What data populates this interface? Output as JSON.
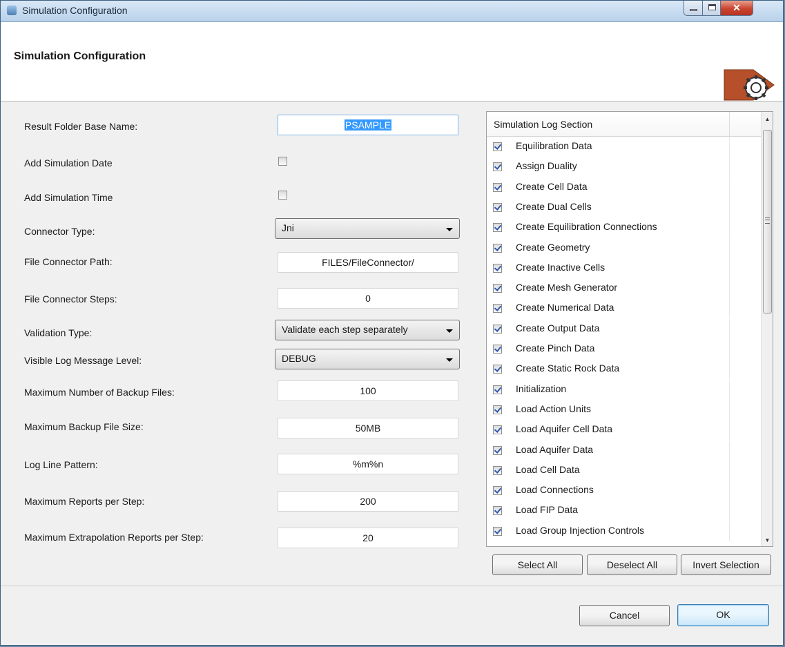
{
  "window": {
    "title": "Simulation Configuration"
  },
  "header": {
    "title": "Simulation Configuration"
  },
  "form": {
    "result_folder_label": "Result Folder Base Name:",
    "result_folder_value": "PSAMPLE",
    "add_date_label": "Add Simulation Date",
    "add_date_checked": false,
    "add_time_label": "Add Simulation Time",
    "add_time_checked": false,
    "connector_type_label": "Connector Type:",
    "connector_type_value": "Jni",
    "file_connector_path_label": "File Connector Path:",
    "file_connector_path_value": "FILES/FileConnector/",
    "file_connector_steps_label": "File Connector Steps:",
    "file_connector_steps_value": "0",
    "validation_type_label": "Validation Type:",
    "validation_type_value": "Validate each step separately",
    "log_level_label": "Visible Log Message Level:",
    "log_level_value": "DEBUG",
    "max_backup_files_label": "Maximum Number of Backup Files:",
    "max_backup_files_value": "100",
    "max_backup_size_label": "Maximum Backup File Size:",
    "max_backup_size_value": "50MB",
    "log_line_pattern_label": "Log Line Pattern:",
    "log_line_pattern_value": "%m%n",
    "max_reports_label": "Maximum Reports per Step:",
    "max_reports_value": "200",
    "max_extrap_reports_label": "Maximum Extrapolation Reports per Step:",
    "max_extrap_reports_value": "20"
  },
  "log_section": {
    "header": "Simulation Log Section",
    "items": [
      {
        "label": "Equilibration Data",
        "checked": true
      },
      {
        "label": "Assign Duality",
        "checked": true
      },
      {
        "label": "Create Cell Data",
        "checked": true
      },
      {
        "label": "Create Dual Cells",
        "checked": true
      },
      {
        "label": "Create Equilibration Connections",
        "checked": true
      },
      {
        "label": "Create Geometry",
        "checked": true
      },
      {
        "label": "Create Inactive Cells",
        "checked": true
      },
      {
        "label": "Create Mesh Generator",
        "checked": true
      },
      {
        "label": "Create Numerical Data",
        "checked": true
      },
      {
        "label": "Create Output Data",
        "checked": true
      },
      {
        "label": "Create Pinch Data",
        "checked": true
      },
      {
        "label": "Create Static Rock Data",
        "checked": true
      },
      {
        "label": "Initialization",
        "checked": true
      },
      {
        "label": "Load Action Units",
        "checked": true
      },
      {
        "label": "Load Aquifer Cell Data",
        "checked": true
      },
      {
        "label": "Load Aquifer Data",
        "checked": true
      },
      {
        "label": "Load Cell Data",
        "checked": true
      },
      {
        "label": "Load Connections",
        "checked": true
      },
      {
        "label": "Load FIP Data",
        "checked": true
      },
      {
        "label": "Load Group Injection Controls",
        "checked": true
      }
    ],
    "select_all_label": "Select All",
    "deselect_all_label": "Deselect All",
    "invert_selection_label": "Invert Selection"
  },
  "footer": {
    "cancel_label": "Cancel",
    "ok_label": "OK"
  },
  "colors": {
    "accent": "#3399ff",
    "logo": "#b5502a",
    "close": "#c9452f"
  },
  "icons": {
    "logo": "gear-icon",
    "close": "close-icon",
    "minimize": "minimize-icon",
    "maximize": "maximize-icon"
  }
}
